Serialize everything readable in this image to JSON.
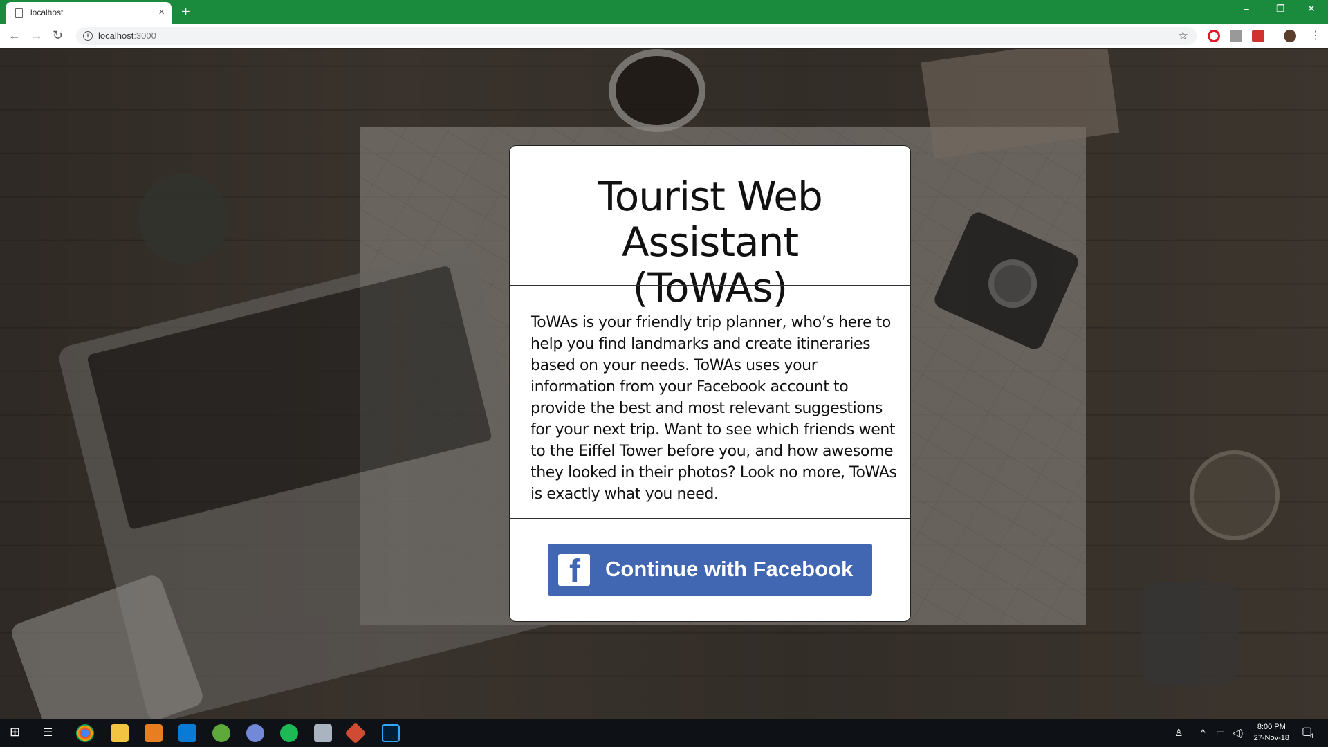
{
  "browser": {
    "tab_title": "localhost",
    "tab_close": "×",
    "new_tab": "+",
    "url_host": "localhost",
    "url_path": ":3000",
    "window_controls": {
      "minimize": "–",
      "restore": "❐",
      "close": "✕"
    }
  },
  "card": {
    "title_line1": "Tourist Web Assistant",
    "title_line2": "(ToWAs)",
    "description": "ToWAs is your friendly trip planner, who’s here to help you find landmarks and create itineraries based on your needs. ToWAs uses your information from your Facebook account to provide the best and most relevant suggestions for your next trip. Want to see which friends went to the Eiffel Tower before you, and how awesome they looked in their photos? Look no more, ToWAs is exactly what you need.",
    "facebook_button": "Continue with Facebook",
    "facebook_icon_letter": "f"
  },
  "taskbar": {
    "time": "8:00 PM",
    "date": "27-Nov-18",
    "notifications": "4"
  },
  "colors": {
    "tabbar": "#1a8a3c",
    "facebook": "#4267b2"
  }
}
